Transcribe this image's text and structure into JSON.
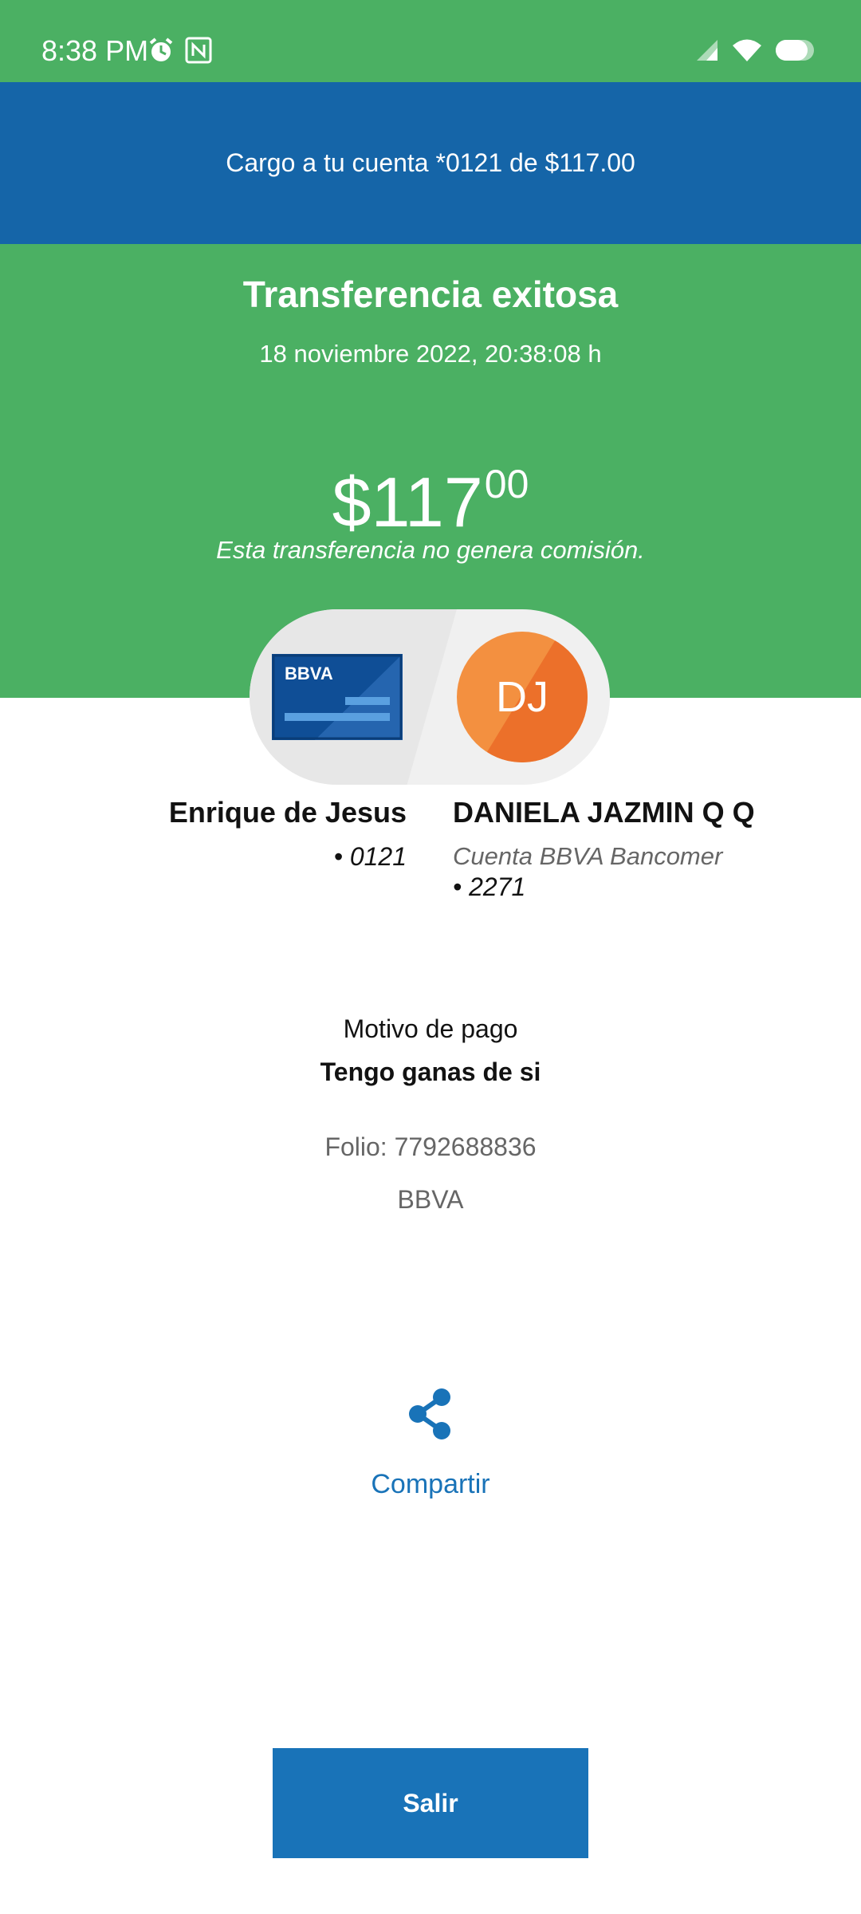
{
  "status_bar": {
    "time": "8:38 PM",
    "left_icons": [
      "alarm-icon",
      "nfc-icon"
    ],
    "right_icons": [
      "signal-icon",
      "wifi-icon",
      "battery-icon"
    ]
  },
  "charge_banner": {
    "text": "Cargo a tu cuenta *0121 de $117.00"
  },
  "hero": {
    "title": "Transferencia exitosa",
    "date": "18 noviembre 2022, 20:38:08 h",
    "amount_main": "$117",
    "amount_cents": "00",
    "note": "Esta transferencia no genera comisión."
  },
  "parties": {
    "card_brand": "BBVA",
    "recipient_initials": "DJ",
    "sender": {
      "name": "Enrique de Jesus",
      "account": "• 0121"
    },
    "recipient": {
      "name": "DANIELA JAZMIN Q Q",
      "bank": "Cuenta BBVA Bancomer",
      "account": "• 2271"
    }
  },
  "details": {
    "motivo_label": "Motivo de pago",
    "motivo_value": "Tengo ganas de si",
    "folio": "Folio: 7792688836",
    "bank": "BBVA"
  },
  "actions": {
    "share_label": "Compartir",
    "exit_label": "Salir"
  },
  "colors": {
    "green": "#4bb063",
    "navy": "#1565a8",
    "accent_blue": "#1973b8",
    "avatar_orange": "#f28c3a"
  }
}
